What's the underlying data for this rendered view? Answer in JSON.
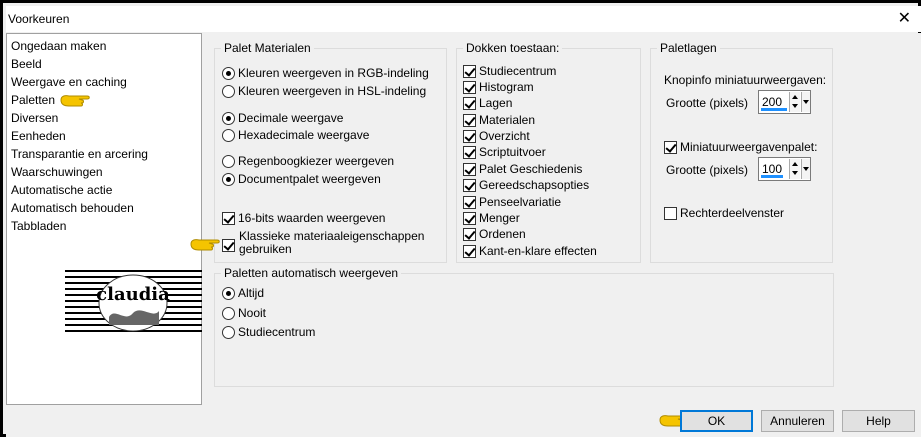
{
  "window": {
    "title": "Voorkeuren",
    "close_glyph": "✕"
  },
  "categories": [
    "Ongedaan maken",
    "Beeld",
    "Weergave en caching",
    "Paletten",
    "Diversen",
    "Eenheden",
    "Transparantie en arcering",
    "Waarschuwingen",
    "Automatische actie",
    "Automatisch behouden",
    "Tabbladen"
  ],
  "selected_category": "Paletten",
  "logo": {
    "icon": "claudia-watermark-logo",
    "text": "claudia"
  },
  "palet_materialen": {
    "title": "Palet Materialen",
    "rgb": "Kleuren weergeven in RGB-indeling",
    "hsl": "Kleuren weergeven in HSL-indeling",
    "decimal": "Decimale weergave",
    "hex": "Hexadecimale weergave",
    "rainbow": "Regenboogkiezer weergeven",
    "docpalette": "Documentpalet weergeven",
    "bits16": "16-bits waarden weergeven",
    "classic_line1": "Klassieke materiaaleigenschappen",
    "classic_line2": "gebruiken"
  },
  "dokken": {
    "title": "Dokken toestaan:",
    "items": [
      "Studiecentrum",
      "Histogram",
      "Lagen",
      "Materialen",
      "Overzicht",
      "Scriptuitvoer",
      "Palet Geschiedenis",
      "Gereedschapsopties",
      "Penseelvariatie",
      "Menger",
      "Ordenen",
      "Kant-en-klare effecten"
    ]
  },
  "paletlagen": {
    "title": "Paletlagen",
    "knopinfo": "Knopinfo miniatuurweergaven:",
    "grootte1_label": "Grootte (pixels)",
    "grootte1_value": "200",
    "miniatuur": "Miniatuurweergavenpalet:",
    "grootte2_label": "Grootte (pixels)",
    "grootte2_value": "100",
    "rechter": "Rechterdeelvenster"
  },
  "auto_weergeven": {
    "title": "Paletten automatisch weergeven",
    "altijd": "Altijd",
    "nooit": "Nooit",
    "studiecentrum": "Studiecentrum"
  },
  "buttons": {
    "ok": "OK",
    "annuleren": "Annuleren",
    "help": "Help"
  },
  "colors": {
    "pointer": "#f5c400",
    "accent": "#0078d7",
    "spin_fill": "#1e90ff"
  }
}
